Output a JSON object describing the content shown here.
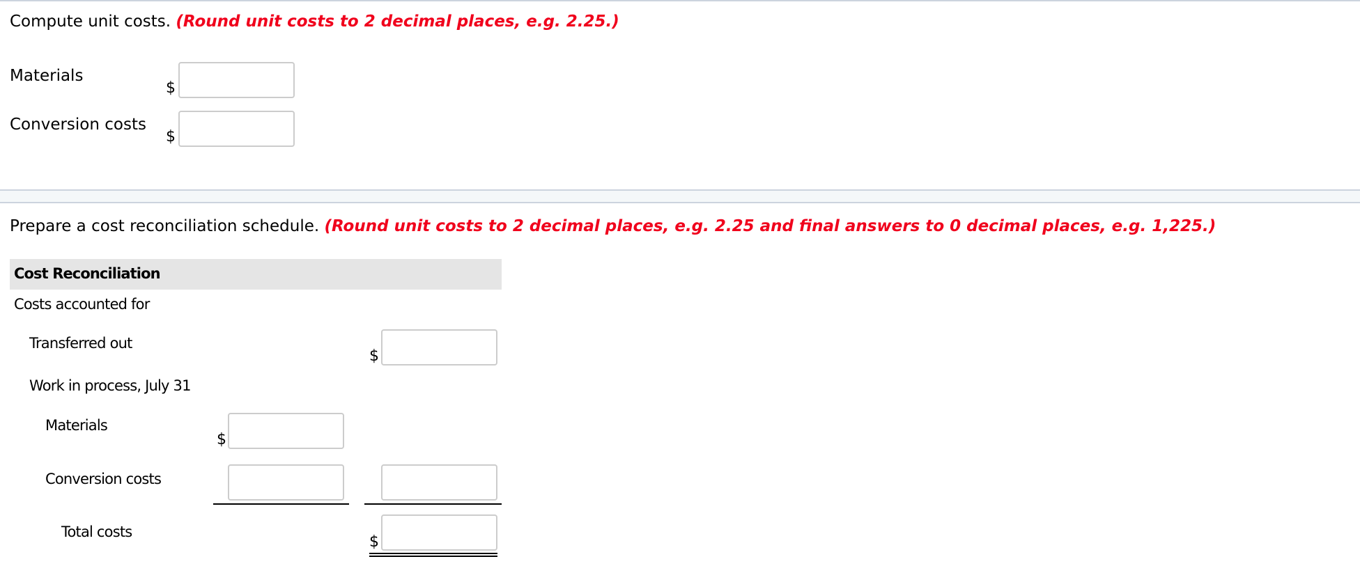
{
  "section1": {
    "prompt": "Compute unit costs.",
    "instruction": "(Round unit costs to 2 decimal places, e.g. 2.25.)",
    "rows": [
      {
        "label": "Materials",
        "currency": "$",
        "value": "",
        "placeholder": ""
      },
      {
        "label": "Conversion costs",
        "currency": "$",
        "value": "",
        "placeholder": ""
      }
    ]
  },
  "section2": {
    "prompt": "Prepare a cost reconciliation schedule.",
    "instruction": "(Round unit costs to 2 decimal places, e.g. 2.25 and final answers to 0 decimal places, e.g. 1,225.)",
    "table": {
      "title": "Cost Reconciliation",
      "group_label": "Costs accounted for",
      "transferred_out": {
        "label": "Transferred out",
        "currency": "$",
        "value": ""
      },
      "wip_label": "Work in process, July 31",
      "wip_materials": {
        "label": "Materials",
        "currency": "$",
        "value": ""
      },
      "wip_conversion": {
        "label": "Conversion costs",
        "value": "",
        "total_value": ""
      },
      "total": {
        "label": "Total costs",
        "currency": "$",
        "value": ""
      }
    }
  },
  "colors": {
    "instruction_red": "#f0001c",
    "header_gray": "#e5e5e5",
    "separator_fill": "#f4f7f9",
    "separator_line": "#ccd3de",
    "input_border": "#cccccc"
  }
}
